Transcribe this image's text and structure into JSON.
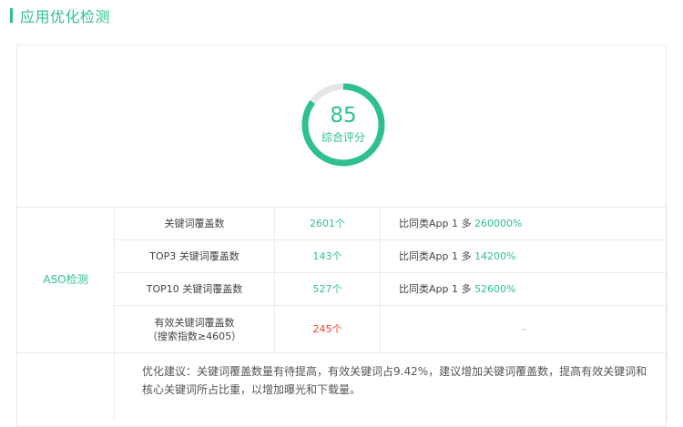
{
  "header": {
    "title": "应用优化检测"
  },
  "score": {
    "value": "85",
    "label": "综合评分",
    "percent": 85,
    "color": "#2fc08f",
    "track_color": "#e6e6e6"
  },
  "aso": {
    "section_label": "ASO检测",
    "rows": [
      {
        "metric": "关键词覆盖数",
        "value": "2601个",
        "compare_prefix": "比同类App 1 多 ",
        "compare_value": "260000%"
      },
      {
        "metric": "TOP3 关键词覆盖数",
        "value": "143个",
        "compare_prefix": "比同类App 1 多 ",
        "compare_value": "14200%"
      },
      {
        "metric": "TOP10 关键词覆盖数",
        "value": "527个",
        "compare_prefix": "比同类App 1 多 ",
        "compare_value": "52600%"
      },
      {
        "metric_line1": "有效关键词覆盖数",
        "metric_line2": "（搜索指数≥4605）",
        "value": "245个",
        "compare": "-"
      }
    ],
    "suggestion": "优化建议：关键词覆盖数量有待提高，有效关键词占9.42%，建议增加关键词覆盖数，提高有效关键词和核心关键词所占比重，以增加曝光和下载量。"
  },
  "colors": {
    "accent": "#2fc08f",
    "warning": "#ff3b30",
    "border": "#ebebeb"
  }
}
